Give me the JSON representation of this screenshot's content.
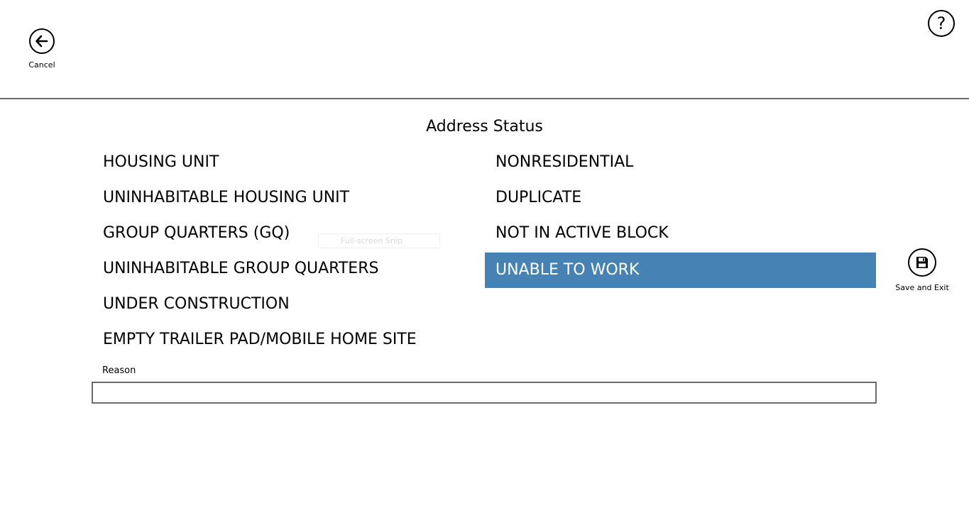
{
  "toolbar": {
    "cancel_label": "Cancel",
    "cancel_icon": "arrow-left-circle-icon",
    "help_label": "?",
    "help_icon": "question-circle-icon"
  },
  "address_status": {
    "title": "Address Status",
    "left_options": [
      {
        "label": "HOUSING UNIT",
        "selected": false
      },
      {
        "label": "UNINHABITABLE HOUSING UNIT",
        "selected": false
      },
      {
        "label": "GROUP QUARTERS (GQ)",
        "selected": false
      },
      {
        "label": "UNINHABITABLE GROUP QUARTERS",
        "selected": false
      },
      {
        "label": "UNDER CONSTRUCTION",
        "selected": false
      },
      {
        "label": "EMPTY TRAILER PAD/MOBILE HOME SITE",
        "selected": false
      }
    ],
    "right_options": [
      {
        "label": "NONRESIDENTIAL",
        "selected": false
      },
      {
        "label": "DUPLICATE",
        "selected": false
      },
      {
        "label": "NOT IN ACTIVE BLOCK",
        "selected": false
      },
      {
        "label": "UNABLE TO WORK",
        "selected": true
      }
    ],
    "selected_color": "#4682b4"
  },
  "overlay": {
    "snip_label": "Full-screen Snip"
  },
  "actions": {
    "save_label": "Save and Exit",
    "save_icon": "floppy-disk-icon"
  },
  "reason": {
    "label": "Reason",
    "value": "",
    "placeholder": ""
  }
}
